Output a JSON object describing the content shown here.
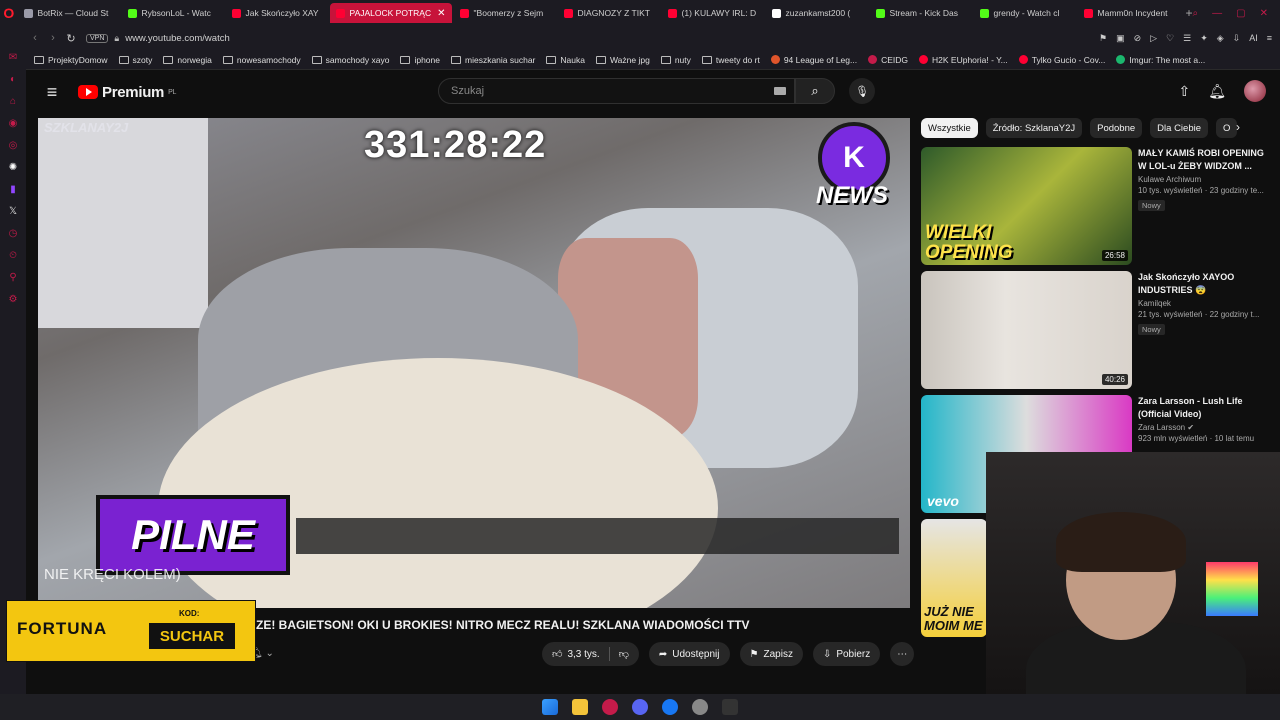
{
  "browser": {
    "tabs": [
      {
        "label": "BotRix — Cloud St",
        "color": "#9a9aa8"
      },
      {
        "label": "RybsonLoL - Watc",
        "color": "#53fc18"
      },
      {
        "label": "Jak Skończyło XAY",
        "color": "#ff0033"
      },
      {
        "label": "PAJALOCK POTRĄC",
        "color": "#ff0033"
      },
      {
        "label": "\"Boomerzy z Sejm",
        "color": "#ff0033"
      },
      {
        "label": "DIAGNOZY Z TIKT",
        "color": "#ff0033"
      },
      {
        "label": "(1) KULAWY IRL: D",
        "color": "#ff0033"
      },
      {
        "label": "zuzankamst200 (",
        "color": "#ffffff"
      },
      {
        "label": "Stream - Kick Das",
        "color": "#53fc18"
      },
      {
        "label": "grendy - Watch cl",
        "color": "#53fc18"
      },
      {
        "label": "Mamm0n Incydent",
        "color": "#ff0033"
      }
    ],
    "active_tab_index": 3,
    "url": "www.youtube.com/watch",
    "vpn_label": "VPN",
    "ai_label": "AI",
    "bookmarks": [
      {
        "label": "ProjektyDomow",
        "type": "folder"
      },
      {
        "label": "szoty",
        "type": "folder"
      },
      {
        "label": "norwegia",
        "type": "folder"
      },
      {
        "label": "nowesamochody",
        "type": "folder"
      },
      {
        "label": "samochody xayo",
        "type": "folder"
      },
      {
        "label": "iphone",
        "type": "folder"
      },
      {
        "label": "mieszkania suchar",
        "type": "folder"
      },
      {
        "label": "Nauka",
        "type": "folder"
      },
      {
        "label": "Ważne jpg",
        "type": "folder"
      },
      {
        "label": "nuty",
        "type": "folder"
      },
      {
        "label": "tweety do rt",
        "type": "folder"
      },
      {
        "label": "94 League of Leg...",
        "type": "site",
        "color": "#e0552b"
      },
      {
        "label": "CEIDG",
        "type": "site",
        "color": "#c41b4a"
      },
      {
        "label": "H2K EUphoria! - Y...",
        "type": "site",
        "color": "#ff0033"
      },
      {
        "label": "Tylko Gucio - Cov...",
        "type": "site",
        "color": "#ff0033"
      },
      {
        "label": "Imgur: The most a...",
        "type": "site",
        "color": "#1bb76e"
      }
    ]
  },
  "youtube": {
    "logo_text": "Premium",
    "logo_region": "PL",
    "search_placeholder": "Szukaj",
    "video": {
      "timer": "331:28:22",
      "watermark": "SZKLANAY2J",
      "news_label": "NEWS",
      "pilne_label": "PILNE",
      "ticker_text": "NIE KRĘCI KOLEM)",
      "title": "ZE! BAGIETSON! OKI U BROKIES! NITRO MECZ REALU! SZKLANA WIADOMOŚCI TTV",
      "likes": "3,3 tys.",
      "share_label": "Udostępnij",
      "save_label": "Zapisz",
      "download_label": "Pobierz"
    },
    "ad": {
      "brand": "FORTUNA",
      "code_label": "KOD:",
      "code": "SUCHAR"
    },
    "chips": [
      "Wszystkie",
      "Źródło: SzklanaY2J",
      "Podobne",
      "Dla Ciebie",
      "O"
    ],
    "recommendations": [
      {
        "title": "MAŁY KAMIŚ ROBI OPENING W LOL-u ŻEBY WIDZOM ...",
        "channel": "Kulawe Archiwum",
        "views": "10 tys. wyświetleń · 23 godziny te...",
        "badge": "Nowy",
        "duration": "26:58",
        "thumb_text": "WIELKI OPENING"
      },
      {
        "title": "Jak Skończyło XAYOO INDUSTRIES 😨",
        "channel": "Kamilqek",
        "views": "21 tys. wyświetleń · 22 godziny t...",
        "badge": "Nowy",
        "duration": "40:26",
        "thumb_text": ""
      },
      {
        "title": "Zara Larsson - Lush Life (Official Video)",
        "channel": "Zara Larsson",
        "views": "923 mln wyświetleń · 10 lat temu",
        "badge": "",
        "duration": "",
        "thumb_text": "vevo"
      },
      {
        "title": "",
        "channel": "",
        "views": "",
        "badge": "",
        "duration": "",
        "thumb_text": "JUŻ NIE MOIM ME"
      }
    ]
  }
}
